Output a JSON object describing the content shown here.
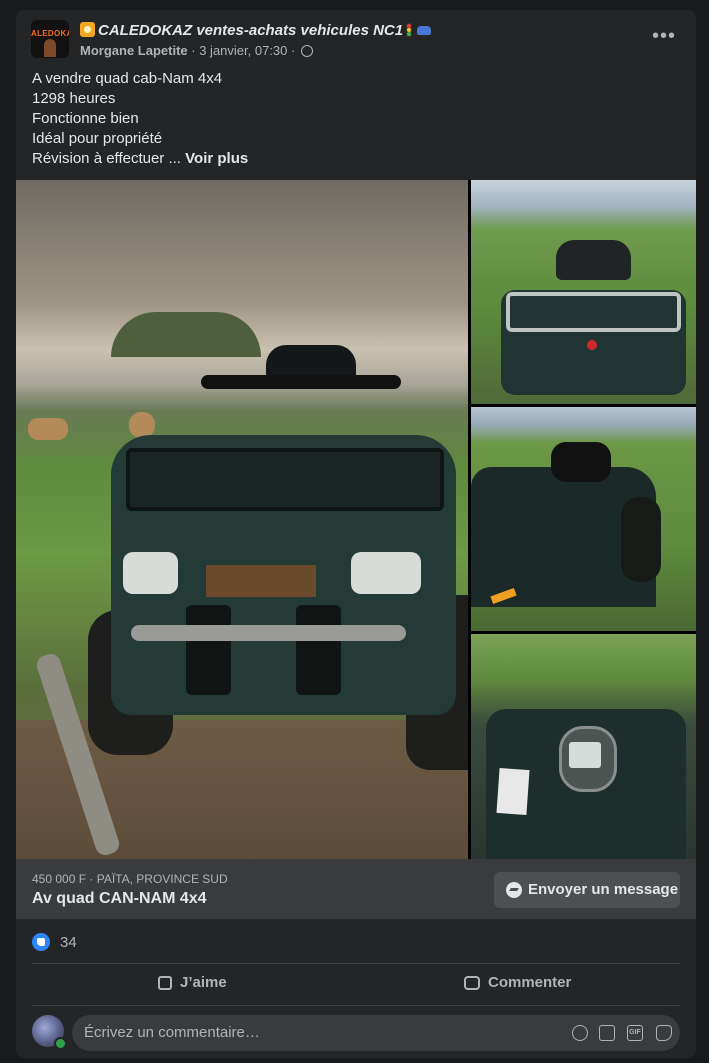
{
  "post": {
    "group_name": "CALEDOKAZ ventes-achats vehicules NC1",
    "group_logo_text": "ALEDOKA",
    "author": "Morgane Lapetite",
    "timestamp": "3 janvier, 07:30",
    "separator": "·",
    "more_label": "•••",
    "text_lines": [
      "A vendre quad cab-Nam 4x4",
      "1298 heures",
      "Fonctionne bien",
      "Idéal pour propriété",
      "Révision à effectuer ..."
    ],
    "see_more": "Voir plus"
  },
  "listing": {
    "price_location": "450 000 F · PAÏTA, PROVINCE SUD",
    "title": "Av quad CAN-NAM 4x4",
    "message_button": "Envoyer un message"
  },
  "reactions": {
    "count": "34"
  },
  "actions": {
    "like": "J’aime",
    "comment": "Commenter"
  },
  "comment_box": {
    "placeholder": "Écrivez un commentaire…",
    "gif_label": "GIF"
  },
  "icons": {
    "group_emoji": "sun-emoji-icon",
    "traffic_light": "traffic-light-icon",
    "car": "car-icon",
    "audience": "globe-icon",
    "messenger": "messenger-icon",
    "like_badge": "like-reaction-icon",
    "like_action": "thumbs-up-icon",
    "comment_action": "comment-bubble-icon",
    "emoji": "emoji-icon",
    "camera": "camera-icon",
    "gif": "gif-icon",
    "sticker": "sticker-icon"
  },
  "colors": {
    "page_bg": "#18191a",
    "card_bg": "#242526",
    "listing_bg": "#3a3b3c",
    "accent_blue": "#2d88ff",
    "text_primary": "#e4e6eb",
    "text_secondary": "#b0b3b8"
  }
}
